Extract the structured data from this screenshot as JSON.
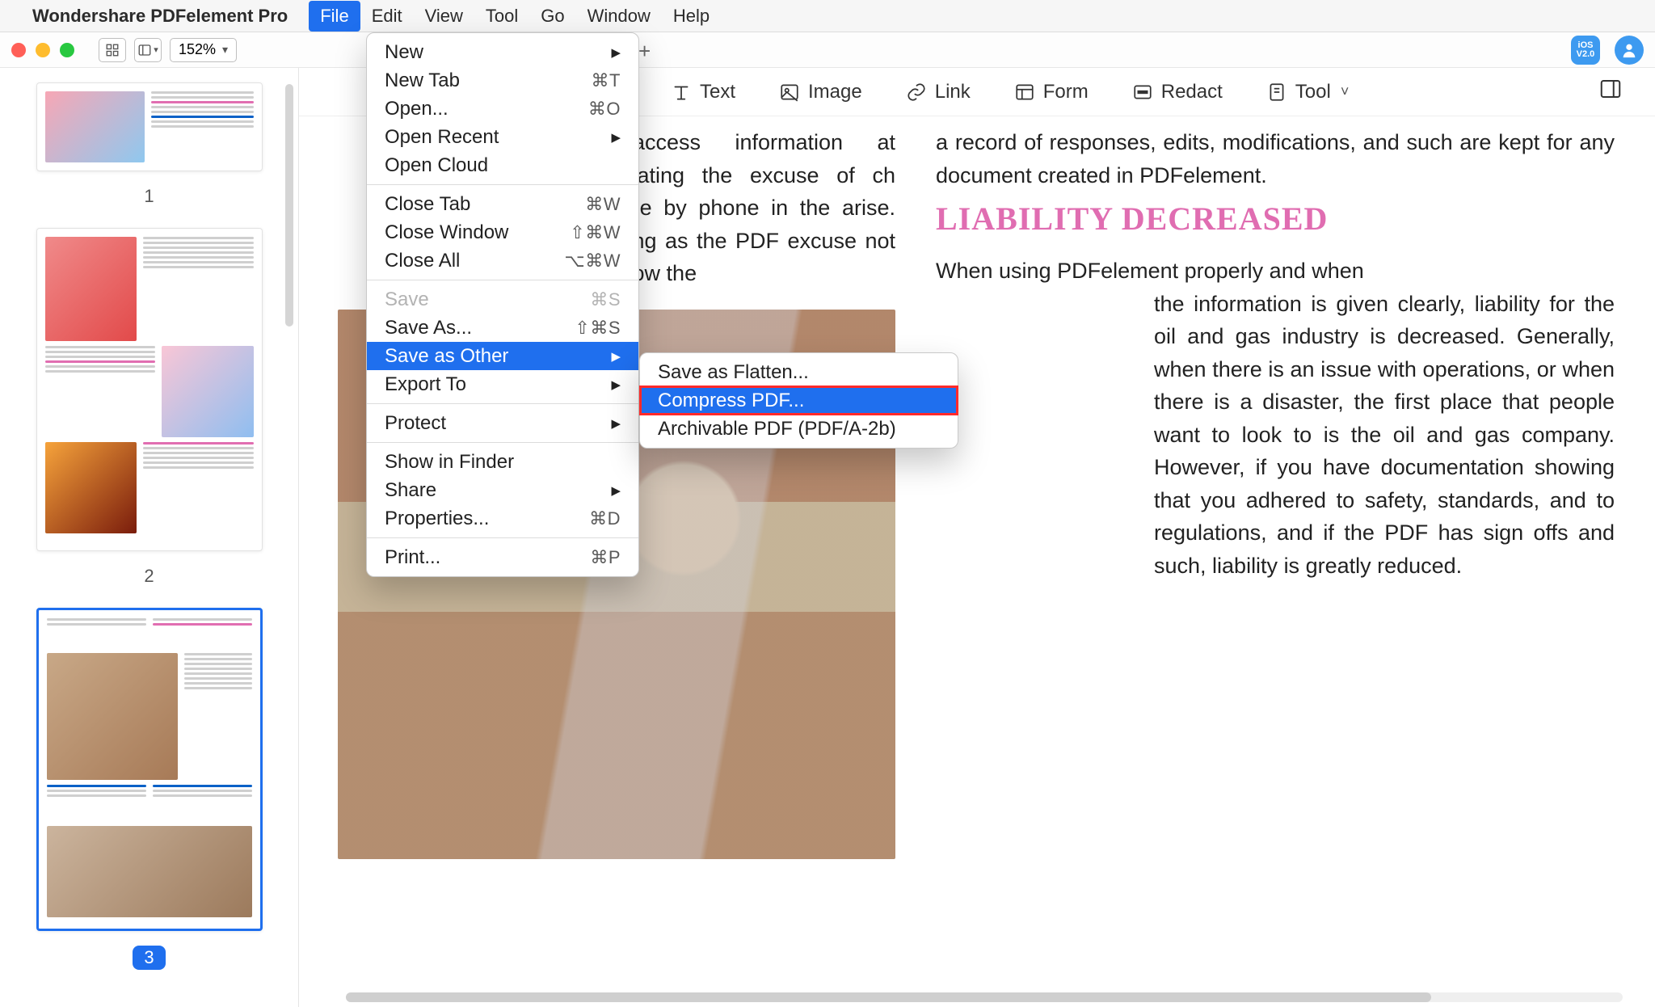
{
  "menubar": {
    "app_name": "Wondershare PDFelement Pro",
    "items": [
      "File",
      "Edit",
      "View",
      "Tool",
      "Go",
      "Window",
      "Help"
    ],
    "active_index": 0
  },
  "chrome": {
    "zoom": "152%",
    "ios_badge_top": "iOS",
    "ios_badge_bottom": "V2.0"
  },
  "toolbar": {
    "text": "Text",
    "image": "Image",
    "link": "Link",
    "form": "Form",
    "redact": "Redact",
    "tool": "Tool"
  },
  "sidebar": {
    "pages": [
      "1",
      "2",
      "3"
    ],
    "selected_index": 2
  },
  "file_menu": {
    "new": {
      "label": "New",
      "arrow": true
    },
    "new_tab": {
      "label": "New Tab",
      "shortcut": "⌘T"
    },
    "open": {
      "label": "Open...",
      "shortcut": "⌘O"
    },
    "open_recent": {
      "label": "Open Recent",
      "arrow": true
    },
    "open_cloud": {
      "label": "Open Cloud"
    },
    "close_tab": {
      "label": "Close Tab",
      "shortcut": "⌘W"
    },
    "close_window": {
      "label": "Close Window",
      "shortcut": "⇧⌘W"
    },
    "close_all": {
      "label": "Close All",
      "shortcut": "⌥⌘W"
    },
    "save": {
      "label": "Save",
      "shortcut": "⌘S",
      "disabled": true
    },
    "save_as": {
      "label": "Save As...",
      "shortcut": "⇧⌘S"
    },
    "save_as_other": {
      "label": "Save as Other",
      "arrow": true,
      "selected": true
    },
    "export_to": {
      "label": "Export To",
      "arrow": true
    },
    "protect": {
      "label": "Protect",
      "arrow": true
    },
    "show_finder": {
      "label": "Show in Finder"
    },
    "share": {
      "label": "Share",
      "arrow": true
    },
    "properties": {
      "label": "Properties...",
      "shortcut": "⌘D"
    },
    "print": {
      "label": "Print...",
      "shortcut": "⌘P"
    }
  },
  "save_as_other_menu": {
    "flatten": {
      "label": "Save as Flatten..."
    },
    "compress": {
      "label": "Compress PDF...",
      "selected": true
    },
    "archivable": {
      "label": "Archivable PDF (PDF/A-2b)"
    }
  },
  "doc": {
    "colA": "to access information at eliminating the excuse of ch anyone by phone in the arise. So long as the PDF excuse not to follow the",
    "colB_top": "a record of responses, edits, modifications, and such are kept for any document created in PDFelement.",
    "heading": "LIABILITY DECREASED",
    "colB_mid": "When using PDFelement properly and when",
    "colB_body": "the information is given clearly, liability for the oil and gas industry is decreased. Generally, when there is an issue with operations, or when there is a disaster, the first place that people want to look to is the oil and gas company. However, if you have documentation showing that you adhered to safety, standards, and to regulations, and if the PDF has sign offs and such, liability is greatly reduced."
  }
}
